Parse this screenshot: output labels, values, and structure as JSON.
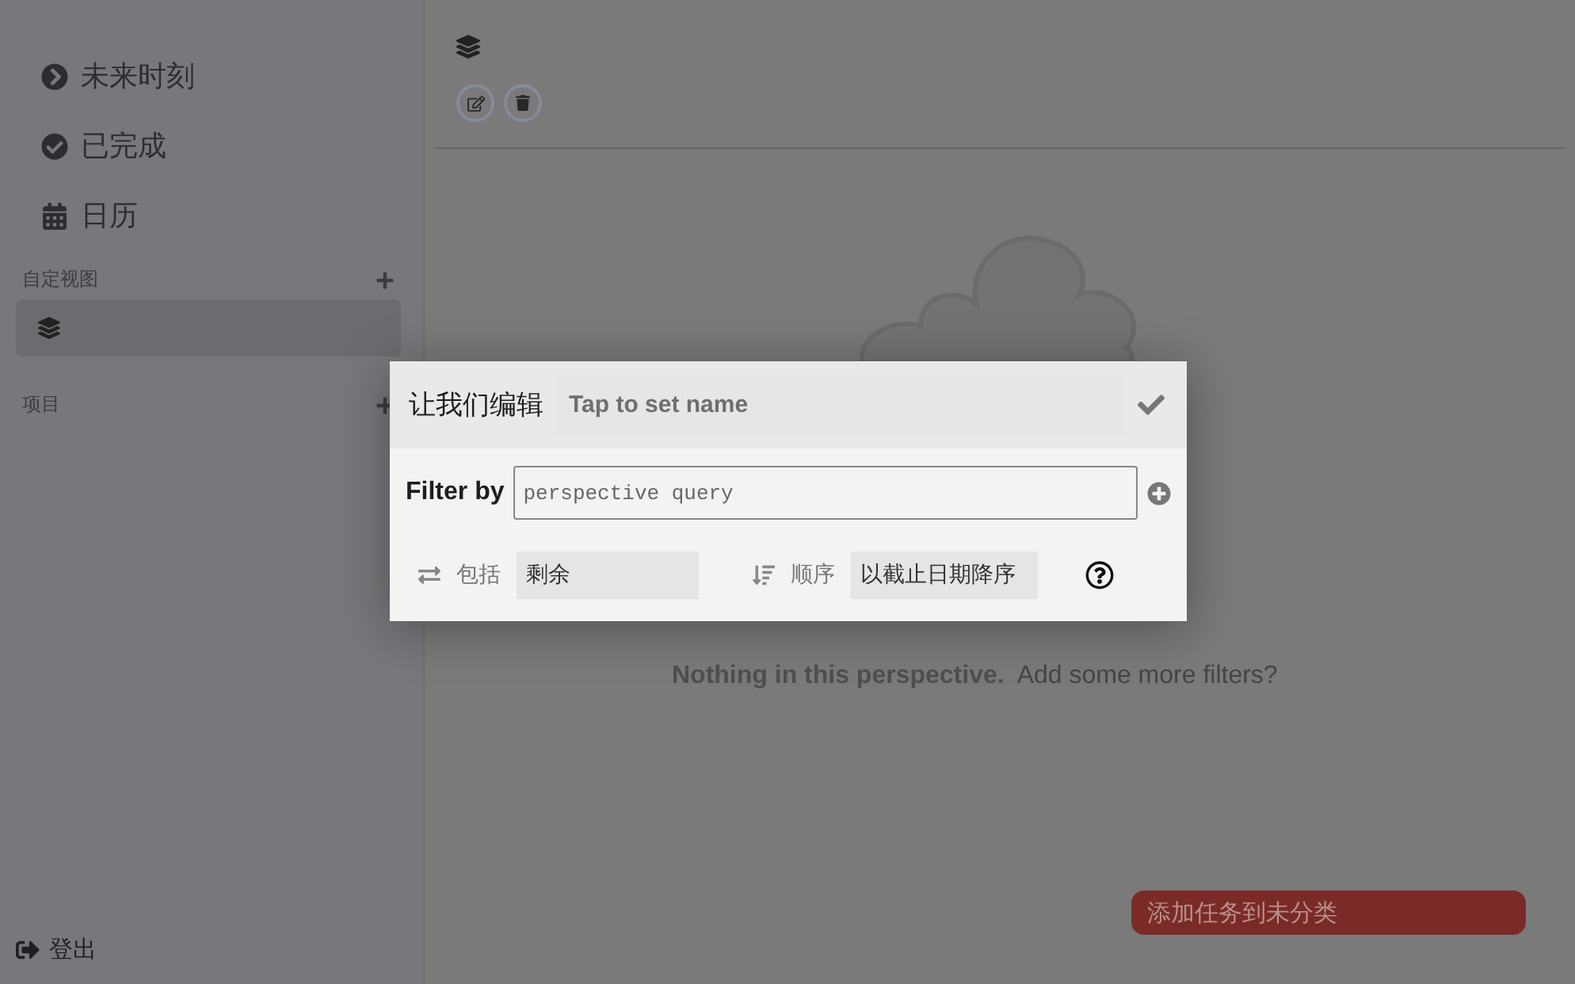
{
  "sidebar": {
    "nav_items": [
      {
        "kind": "upcoming",
        "label": "未来时刻"
      },
      {
        "kind": "done",
        "label": "已完成"
      },
      {
        "kind": "calendar",
        "label": "日历"
      }
    ],
    "sections": [
      {
        "title": "自定视图",
        "items": [
          {
            "selected": true
          }
        ]
      },
      {
        "title": "项目"
      }
    ],
    "logout": "登出"
  },
  "main": {
    "empty_title": "Nothing in this perspective.",
    "empty_hint": "Add some more filters?",
    "add_task_button": "添加任务到未分类"
  },
  "dialog": {
    "title": "让我们编辑",
    "name_placeholder": "Tap to set name",
    "filter_label": "Filter by",
    "filter_placeholder": "perspective query",
    "include_label": "包括",
    "include_value": "剩余",
    "order_label": "顺序",
    "order_value": "以截止日期降序"
  }
}
